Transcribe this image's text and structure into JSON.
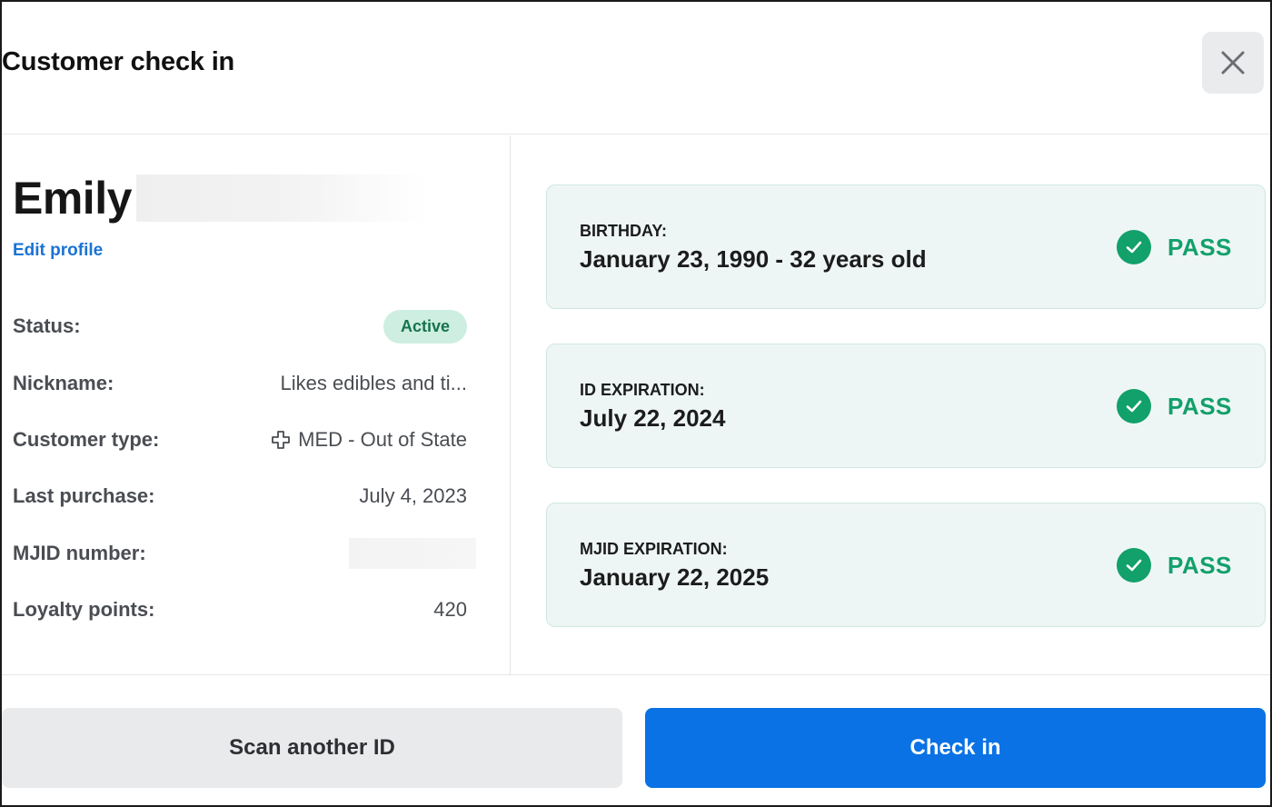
{
  "header": {
    "title": "Customer check in",
    "close_icon": "close-icon"
  },
  "profile": {
    "first_name": "Emily",
    "edit_label": "Edit profile",
    "fields": [
      {
        "label": "Status:",
        "value": "Active"
      },
      {
        "label": "Nickname:",
        "value": "Likes edibles and ti..."
      },
      {
        "label": "Customer type:",
        "value": "MED - Out of State",
        "icon": "medical-cross-icon"
      },
      {
        "label": "Last purchase:",
        "value": "July 4, 2023"
      },
      {
        "label": "MJID number:",
        "value": ""
      },
      {
        "label": "Loyalty points:",
        "value": "420"
      }
    ]
  },
  "checks": [
    {
      "label": "BIRTHDAY:",
      "value": "January 23, 1990 - 32 years old",
      "result": "PASS"
    },
    {
      "label": "ID EXPIRATION:",
      "value": "July 22, 2024",
      "result": "PASS"
    },
    {
      "label": "MJID EXPIRATION:",
      "value": "January 22, 2025",
      "result": "PASS"
    }
  ],
  "footer": {
    "scan_label": "Scan another ID",
    "checkin_label": "Check in"
  },
  "colors": {
    "primary": "#0a72e4",
    "pass": "#12a06b",
    "link": "#1a73d4",
    "active_badge_bg": "#cdeee0",
    "card_bg": "#eef6f5"
  }
}
